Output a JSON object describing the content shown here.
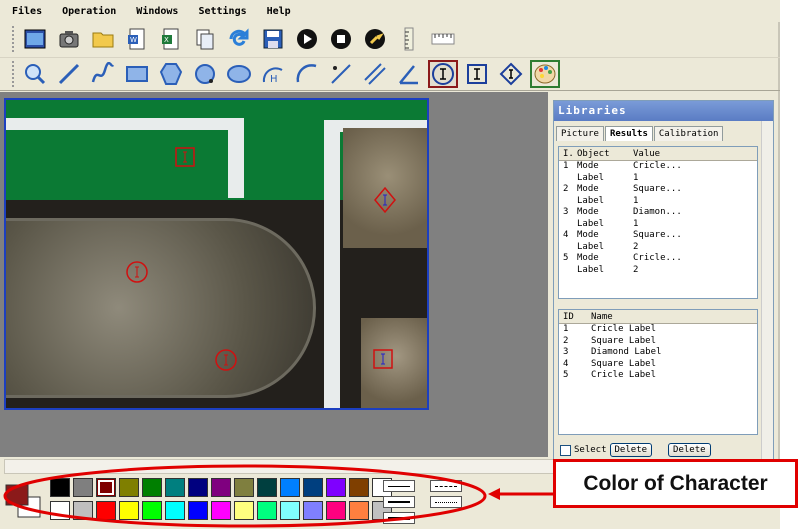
{
  "menu": [
    "Files",
    "Operation",
    "Windows",
    "Settings",
    "Help"
  ],
  "toolbar1": [
    {
      "name": "capture-icon"
    },
    {
      "name": "camera-icon"
    },
    {
      "name": "open-folder-icon"
    },
    {
      "name": "word-export-icon"
    },
    {
      "name": "excel-export-icon"
    },
    {
      "name": "copy-icon"
    },
    {
      "name": "refresh-icon"
    },
    {
      "name": "save-icon"
    },
    {
      "name": "play-icon"
    },
    {
      "name": "stop-icon"
    },
    {
      "name": "settings-wrench-icon"
    },
    {
      "name": "ruler-vertical-icon"
    },
    {
      "name": "ruler-horizontal-icon"
    }
  ],
  "toolbar2": [
    {
      "name": "zoom-icon"
    },
    {
      "name": "line-icon"
    },
    {
      "name": "curve-icon"
    },
    {
      "name": "rectangle-icon"
    },
    {
      "name": "polygon-icon"
    },
    {
      "name": "circle-three-point-icon"
    },
    {
      "name": "ellipse-icon"
    },
    {
      "name": "arc-height-icon"
    },
    {
      "name": "arc-icon"
    },
    {
      "name": "point-line-distance-icon"
    },
    {
      "name": "parallel-lines-icon"
    },
    {
      "name": "angle-icon"
    },
    {
      "name": "circle-label-icon",
      "active": true
    },
    {
      "name": "square-label-icon"
    },
    {
      "name": "diamond-label-icon"
    },
    {
      "name": "palette-icon"
    }
  ],
  "libraries": {
    "title": "Libraries",
    "tabs": [
      "Picture",
      "Results",
      "Calibration"
    ],
    "selected_tab": "Results",
    "results_headers": [
      "I.",
      "Object",
      "Value"
    ],
    "results_rows": [
      [
        "1",
        "Mode",
        "Cricle..."
      ],
      [
        "",
        "Label",
        "1"
      ],
      [
        "2",
        "Mode",
        "Square..."
      ],
      [
        "",
        "Label",
        "1"
      ],
      [
        "3",
        "Mode",
        "Diamon..."
      ],
      [
        "",
        "Label",
        "1"
      ],
      [
        "4",
        "Mode",
        "Square..."
      ],
      [
        "",
        "Label",
        "2"
      ],
      [
        "5",
        "Mode",
        "Cricle..."
      ],
      [
        "",
        "Label",
        "2"
      ]
    ],
    "names_headers": [
      "ID",
      "Name"
    ],
    "names_rows": [
      [
        "1",
        "Cricle Label"
      ],
      [
        "2",
        "Square Label"
      ],
      [
        "3",
        "Diamond Label"
      ],
      [
        "4",
        "Square Label"
      ],
      [
        "5",
        "Cricle Label"
      ]
    ],
    "select_label": "Select",
    "delete_label": "Delete",
    "delete2_label": "Delete"
  },
  "palette": {
    "foreground": "#8b1a1a",
    "background": "#ffffff",
    "row1": [
      "#000000",
      "#7f7f7f",
      "#7f0000",
      "#7f7f00",
      "#007f00",
      "#007f7f",
      "#00007f",
      "#7f007f",
      "#7f7f3f",
      "#003f3f",
      "#007fff",
      "#003f7f",
      "#7f00ff",
      "#7f3f00",
      "#ffffff"
    ],
    "row2": [
      "#ffffff",
      "#bfbfbf",
      "#ff0000",
      "#ffff00",
      "#00ff00",
      "#00ffff",
      "#0000ff",
      "#ff00ff",
      "#ffff7f",
      "#00ff7f",
      "#7fffff",
      "#7f7fff",
      "#ff007f",
      "#ff7f3f",
      "#c0c0c0"
    ],
    "selected_index_row1": 2
  },
  "callout": "Color of Character"
}
